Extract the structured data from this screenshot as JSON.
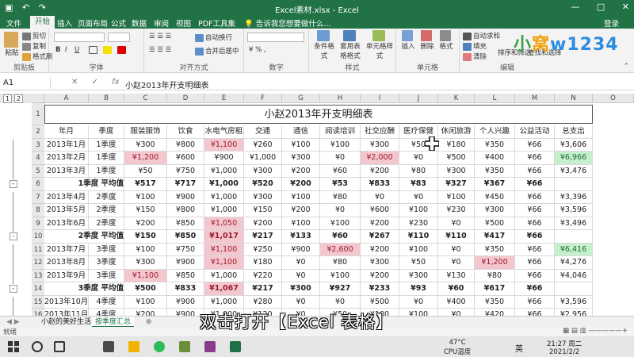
{
  "titlebar": {
    "title": "Excel素材.xlsx - Excel",
    "min": "—",
    "max": "□",
    "close": "✕"
  },
  "tabs": [
    "文件",
    "开始",
    "插入",
    "页面布局",
    "公式",
    "数据",
    "审阅",
    "视图",
    "PDF工具集"
  ],
  "active_tab": "开始",
  "tell_me": "告诉我您想要做什么...",
  "login": "登录",
  "ribbon": {
    "clipboard": {
      "label": "剪贴板",
      "paste": "粘贴",
      "cut": "剪切",
      "copy": "复制",
      "format_painter": "格式刷"
    },
    "font": {
      "label": "字体",
      "bold": "B",
      "italic": "I",
      "underline": "U"
    },
    "alignment": {
      "label": "对齐方式",
      "wrap": "自动换行",
      "merge": "合并后居中"
    },
    "number": {
      "label": "数字"
    },
    "styles": {
      "label": "样式",
      "conditional": "条件格式",
      "table": "套用表格格式",
      "cell_styles": "单元格样式"
    },
    "cells": {
      "label": "单元格",
      "insert": "插入",
      "delete": "删除",
      "format": "格式"
    },
    "editing": {
      "label": "编辑",
      "autosum": "自动求和",
      "fill": "填充",
      "clear": "清除",
      "sort": "排序和筛选",
      "find": "查找和选择"
    }
  },
  "logo": [
    "小",
    "窝",
    "w1234"
  ],
  "formula_bar": {
    "name_box": "A1",
    "fx": "fx",
    "content": "小赵2013年开支明细表"
  },
  "columns": [
    "A",
    "B",
    "C",
    "D",
    "E",
    "F",
    "G",
    "H",
    "I",
    "J",
    "K",
    "L",
    "M",
    "N",
    "O"
  ],
  "sheet_title": "小赵2013年开支明细表",
  "headers": [
    "年月",
    "季度",
    "服装服饰",
    "饮食",
    "水电气房租",
    "交通",
    "通信",
    "阅读培训",
    "社交应酬",
    "医疗保健",
    "休闲旅游",
    "个人兴趣",
    "公益活动",
    "总支出"
  ],
  "rows": [
    {
      "n": "3",
      "cells": [
        "2013年1月",
        "1季度",
        "¥300",
        "¥800",
        "¥1,100",
        "¥260",
        "¥100",
        "¥100",
        "¥300",
        "¥50",
        "¥180",
        "¥350",
        "¥66",
        "¥3,606"
      ],
      "hl": {
        "4": "pink"
      }
    },
    {
      "n": "4",
      "cells": [
        "2013年2月",
        "1季度",
        "¥1,200",
        "¥600",
        "¥900",
        "¥1,000",
        "¥300",
        "¥0",
        "¥2,000",
        "¥0",
        "¥500",
        "¥400",
        "¥66",
        "¥6,966"
      ],
      "hl": {
        "2": "pink",
        "8": "pink",
        "13": "green"
      }
    },
    {
      "n": "5",
      "cells": [
        "2013年3月",
        "1季度",
        "¥50",
        "¥750",
        "¥1,000",
        "¥300",
        "¥200",
        "¥60",
        "¥200",
        "¥80",
        "¥300",
        "¥350",
        "¥66",
        "¥3,476"
      ],
      "hl": {}
    },
    {
      "n": "6",
      "cells": [
        "1季度 平均值",
        "",
        "¥517",
        "¥717",
        "¥1,000",
        "¥520",
        "¥200",
        "¥53",
        "¥833",
        "¥83",
        "¥327",
        "¥367",
        "¥66",
        ""
      ],
      "hl": {},
      "bold": true
    },
    {
      "n": "7",
      "cells": [
        "2013年4月",
        "2季度",
        "¥100",
        "¥900",
        "¥1,000",
        "¥300",
        "¥100",
        "¥80",
        "¥0",
        "¥0",
        "¥100",
        "¥450",
        "¥66",
        "¥3,396"
      ],
      "hl": {}
    },
    {
      "n": "8",
      "cells": [
        "2013年5月",
        "2季度",
        "¥150",
        "¥800",
        "¥1,000",
        "¥150",
        "¥200",
        "¥0",
        "¥600",
        "¥100",
        "¥230",
        "¥300",
        "¥66",
        "¥3,596"
      ],
      "hl": {}
    },
    {
      "n": "9",
      "cells": [
        "2013年6月",
        "2季度",
        "¥200",
        "¥850",
        "¥1,050",
        "¥200",
        "¥100",
        "¥100",
        "¥200",
        "¥230",
        "¥0",
        "¥500",
        "¥66",
        "¥3,496"
      ],
      "hl": {
        "4": "pink"
      }
    },
    {
      "n": "10",
      "cells": [
        "2季度 平均值",
        "",
        "¥150",
        "¥850",
        "¥1,017",
        "¥217",
        "¥133",
        "¥60",
        "¥267",
        "¥110",
        "¥110",
        "¥417",
        "¥66",
        ""
      ],
      "hl": {
        "4": "pink"
      },
      "bold": true
    },
    {
      "n": "11",
      "cells": [
        "2013年7月",
        "3季度",
        "¥100",
        "¥750",
        "¥1,100",
        "¥250",
        "¥900",
        "¥2,600",
        "¥200",
        "¥100",
        "¥0",
        "¥350",
        "¥66",
        "¥6,416"
      ],
      "hl": {
        "4": "pink",
        "7": "pink",
        "13": "green"
      }
    },
    {
      "n": "12",
      "cells": [
        "2013年8月",
        "3季度",
        "¥300",
        "¥900",
        "¥1,100",
        "¥180",
        "¥0",
        "¥80",
        "¥300",
        "¥50",
        "¥0",
        "¥1,200",
        "¥66",
        "¥4,276"
      ],
      "hl": {
        "4": "pink",
        "11": "pink"
      }
    },
    {
      "n": "13",
      "cells": [
        "2013年9月",
        "3季度",
        "¥1,100",
        "¥850",
        "¥1,000",
        "¥220",
        "¥0",
        "¥100",
        "¥200",
        "¥300",
        "¥130",
        "¥80",
        "¥66",
        "¥4,046"
      ],
      "hl": {
        "2": "pink"
      }
    },
    {
      "n": "14",
      "cells": [
        "3季度 平均值",
        "",
        "¥500",
        "¥833",
        "¥1,067",
        "¥217",
        "¥300",
        "¥927",
        "¥233",
        "¥93",
        "¥60",
        "¥617",
        "¥66",
        ""
      ],
      "hl": {
        "4": "pink"
      },
      "bold": true
    },
    {
      "n": "15",
      "cells": [
        "2013年10月",
        "4季度",
        "¥100",
        "¥900",
        "¥1,000",
        "¥280",
        "¥0",
        "¥0",
        "¥500",
        "¥0",
        "¥400",
        "¥350",
        "¥66",
        "¥3,596"
      ],
      "hl": {}
    },
    {
      "n": "16",
      "cells": [
        "2013年11月",
        "4季度",
        "¥200",
        "¥900",
        "¥1,000",
        "¥120",
        "¥0",
        "¥50",
        "¥100",
        "¥100",
        "¥0",
        "¥420",
        "¥66",
        "¥2,956"
      ],
      "hl": {}
    },
    {
      "n": "17",
      "cells": [
        "2013年12月",
        "4季度",
        "¥0",
        "¥1,050",
        "¥1,100",
        "¥350",
        "¥0",
        "¥80",
        "¥500",
        "¥60",
        "¥200",
        "¥400",
        "¥66",
        "¥4,106"
      ],
      "hl": {
        "3": "pink",
        "4": "pink"
      }
    }
  ],
  "sheet_tabs": [
    "小赵的美好生活",
    "按季度汇总"
  ],
  "status": "就绪",
  "caption": "双击打开【Excel 表格】",
  "taskbar": {
    "temp": "47°C",
    "temp_label": "CPU温度",
    "ime": "英",
    "time": "21:27 周二",
    "date": "2021/2/2"
  }
}
